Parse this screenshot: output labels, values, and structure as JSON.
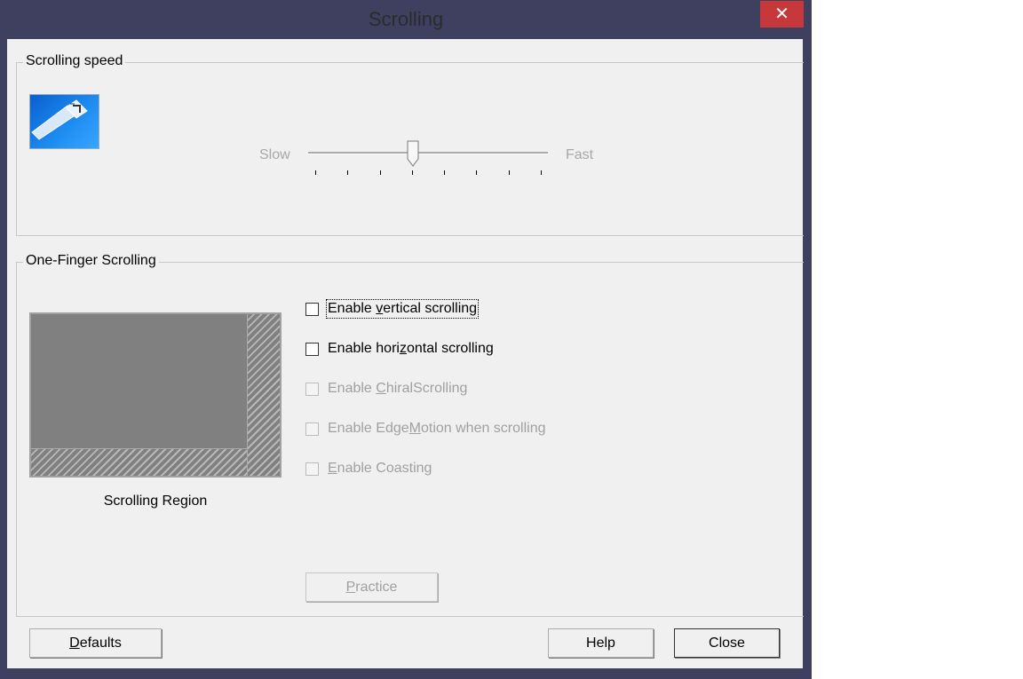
{
  "window": {
    "title": "Scrolling",
    "close_glyph": "✕"
  },
  "speed_group": {
    "legend": "Scrolling speed",
    "icon": "touchpad-scroll-icon",
    "slider": {
      "min_label": "Slow",
      "max_label": "Fast",
      "ticks": 8,
      "value_fraction": 0.43
    }
  },
  "finger_group": {
    "legend": "One-Finger Scrolling",
    "region_caption": "Scrolling Region",
    "options": [
      {
        "pre": "Enable ",
        "key": "v",
        "post": "ertical scrolling",
        "checked": false,
        "enabled": true
      },
      {
        "pre": "Enable hori",
        "key": "z",
        "post": "ontal scrolling",
        "checked": false,
        "enabled": true
      },
      {
        "pre": "Enable ",
        "key": "C",
        "post": "hiralScrolling",
        "checked": false,
        "enabled": false
      },
      {
        "pre": "Enable Edge",
        "key": "M",
        "post": "otion when scrolling",
        "checked": false,
        "enabled": false
      },
      {
        "pre": "",
        "key": "E",
        "post": "nable Coasting",
        "checked": false,
        "enabled": false
      }
    ],
    "practice": {
      "key": "P",
      "rest": "ractice"
    }
  },
  "footer": {
    "defaults": {
      "key": "D",
      "rest": "efaults"
    },
    "help": "Help",
    "close": "Close"
  },
  "colors": {
    "title_bg": "#3f4060",
    "close_bg": "#c7383a",
    "client_bg": "#f0f0f0"
  }
}
